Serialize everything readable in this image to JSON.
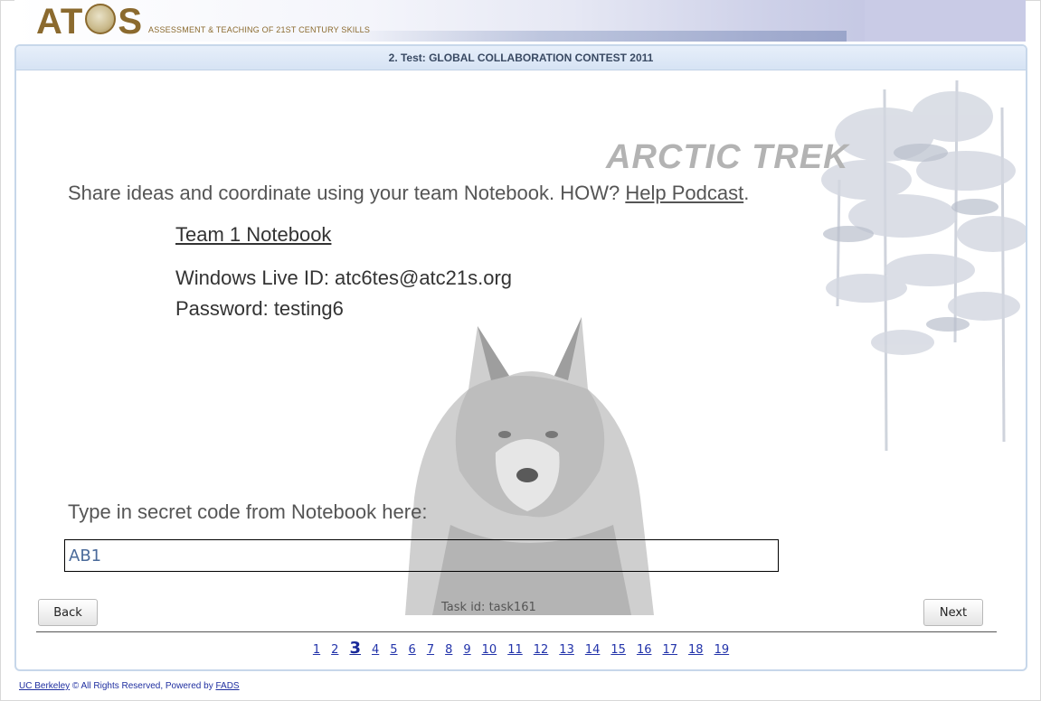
{
  "header": {
    "logo_text_left": "AT",
    "logo_text_right": "S",
    "logo_subtitle": "ASSESSMENT & TEACHING OF 21ST CENTURY SKILLS"
  },
  "panel": {
    "title": "2. Test: GLOBAL COLLABORATION CONTEST 2011",
    "brand": "ARCTIC TREK",
    "instruction_prefix": "Share ideas and coordinate using your team Notebook. HOW? ",
    "help_link": "Help Podcast",
    "instruction_suffix": ".",
    "notebook_link": "Team 1 Notebook",
    "live_id": "Windows Live ID: atc6tes@atc21s.org",
    "password": "Password: testing6",
    "code_label": "Type in secret code from Notebook here:",
    "code_value": "AB1"
  },
  "nav": {
    "back_label": "Back",
    "next_label": "Next",
    "task_id": "Task id: task161",
    "pages": [
      "1",
      "2",
      "3",
      "4",
      "5",
      "6",
      "7",
      "8",
      "9",
      "10",
      "11",
      "12",
      "13",
      "14",
      "15",
      "16",
      "17",
      "18",
      "19"
    ],
    "current_page": "3"
  },
  "footer": {
    "org_link": "UC Berkeley",
    "rights": " © All Rights Reserved,   Powered by ",
    "powered_link": "FADS"
  },
  "colors": {
    "title_bar": "#d6e3f4",
    "link_blue": "#2233aa",
    "logo_gold": "#8b6a2e"
  }
}
